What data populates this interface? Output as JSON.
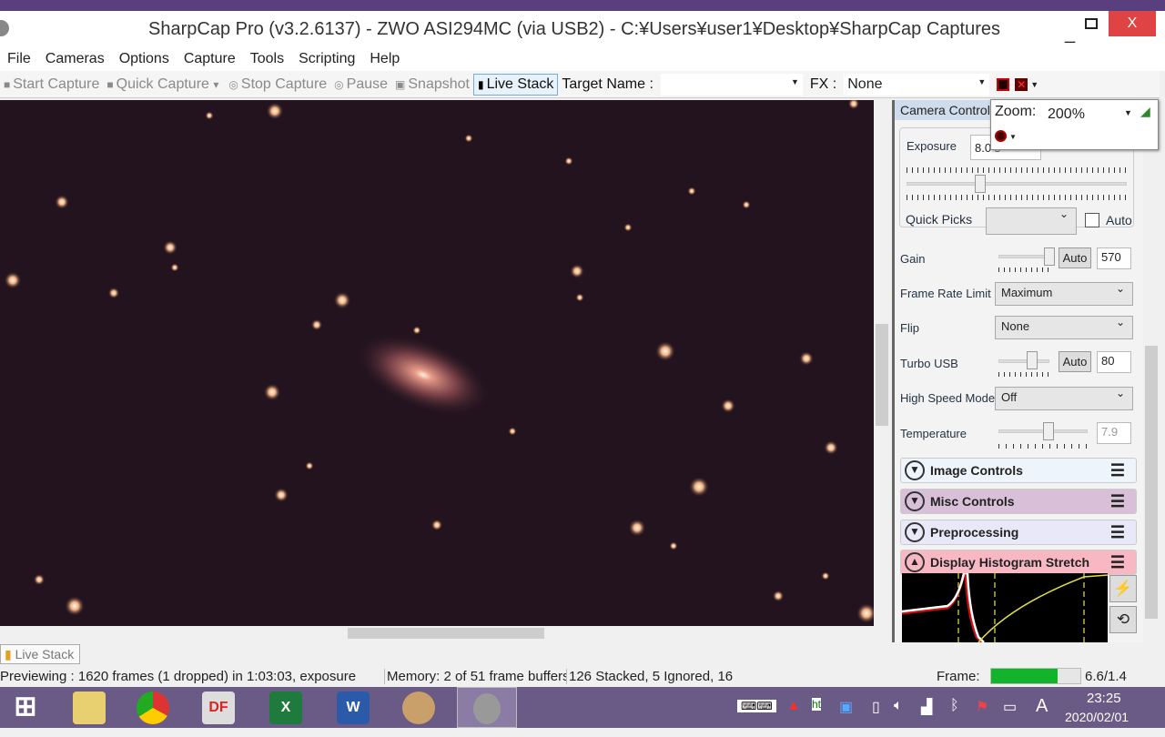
{
  "window": {
    "title": "SharpCap Pro (v3.2.6137) - ZWO ASI294MC (via USB2) - C:¥Users¥user1¥Desktop¥SharpCap Captures",
    "minimize": "_",
    "close": "X"
  },
  "menu": [
    "File",
    "Cameras",
    "Options",
    "Capture",
    "Tools",
    "Scripting",
    "Help"
  ],
  "toolbar": {
    "start_capture": "Start Capture",
    "quick_capture": "Quick Capture",
    "stop_capture": "Stop Capture",
    "pause": "Pause",
    "snapshot": "Snapshot",
    "live_stack": "Live Stack",
    "target_name_label": "Target Name :",
    "target_name_value": "",
    "fx_label": "FX :",
    "fx_value": "None"
  },
  "zoom": {
    "label": "Zoom:",
    "value": "200%"
  },
  "panel": {
    "camera_controls_title": "Camera Controls",
    "exposure_label": "Exposure",
    "exposure_value": "8.0 s",
    "quick_picks_label": "Quick Picks",
    "quick_picks_value": "",
    "auto_label": "Auto",
    "auto_checked": false,
    "gain_label": "Gain",
    "gain_auto": "Auto",
    "gain_value": "570",
    "frame_rate_label": "Frame Rate Limit",
    "frame_rate_value": "Maximum",
    "flip_label": "Flip",
    "flip_value": "None",
    "turbo_label": "Turbo USB",
    "turbo_auto": "Auto",
    "turbo_value": "80",
    "hsm_label": "High Speed Mode",
    "hsm_value": "Off",
    "temp_label": "Temperature",
    "temp_value": "7.9",
    "sections": [
      {
        "title": "Image Controls",
        "color": "#eef4fb",
        "expanded": false
      },
      {
        "title": "Misc Controls",
        "color": "#d9c0d9",
        "expanded": false
      },
      {
        "title": "Preprocessing",
        "color": "#e8e8f8",
        "expanded": false
      },
      {
        "title": "Display Histogram Stretch",
        "color": "#f7b8c4",
        "expanded": true
      }
    ]
  },
  "tab": {
    "label": "Live Stack"
  },
  "status": {
    "preview": "Previewing : 1620 frames (1 dropped) in 1:03:03, exposure",
    "memory": "Memory: 2 of 51 frame buffers",
    "stack": "126 Stacked, 5 Ignored, 16",
    "frame_label": "Frame:",
    "frame_ratio": "6.6/1.4",
    "frame_color": "#12b52a"
  },
  "taskbar": {
    "apps": [
      "windows-start",
      "file-explorer",
      "chrome",
      "docuworks",
      "excel",
      "word",
      "paint",
      "sharpcap"
    ],
    "app_labels": {
      "df": "DF",
      "excel": "X",
      "word": "W"
    },
    "ime": "A",
    "time": "23:25",
    "date": "2020/02/01"
  }
}
